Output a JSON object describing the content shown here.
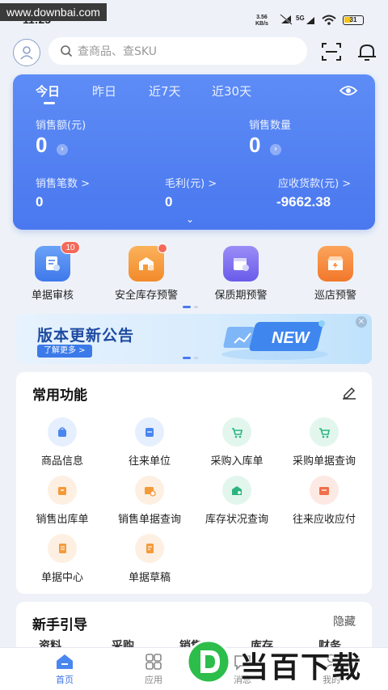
{
  "status_bar": {
    "time": "11:25",
    "watermark": "www.downbai.com",
    "net_speed_value": "3.56",
    "net_speed_unit": "KB/s",
    "signal_label": "5G",
    "battery": "31"
  },
  "header": {
    "search_placeholder": "查商品、查SKU"
  },
  "sales": {
    "tabs": [
      "今日",
      "昨日",
      "近7天",
      "近30天"
    ],
    "active_tab": 0,
    "sales_amount_label": "销售额(元)",
    "sales_amount_value": "0",
    "sales_qty_label": "销售数量",
    "sales_qty_value": "0",
    "order_count_label": "销售笔数 >",
    "order_count_value": "0",
    "gross_profit_label": "毛利(元) >",
    "gross_profit_value": "0",
    "receivable_label": "应收货款(元) >",
    "receivable_value": "-9662.38"
  },
  "alerts": [
    {
      "label": "单据审核",
      "badge": "10",
      "color": "#4a86f0"
    },
    {
      "label": "安全库存预警",
      "badge": "",
      "color": "#f59a3b"
    },
    {
      "label": "保质期预警",
      "badge": "",
      "color": "#7a6cf0"
    },
    {
      "label": "巡店预警",
      "badge": "",
      "color": "#f58a3b"
    }
  ],
  "banner": {
    "title": "版本更新公告",
    "more": "了解更多 >",
    "art_text": "NEW"
  },
  "functions": {
    "title": "常用功能",
    "items": [
      {
        "label": "商品信息",
        "icon": "bag-icon",
        "color": "#4a86f0",
        "bg": "#e6effd"
      },
      {
        "label": "往来单位",
        "icon": "contact-card-icon",
        "color": "#4a86f0",
        "bg": "#e6effd"
      },
      {
        "label": "采购入库单",
        "icon": "cart-in-icon",
        "color": "#2bb57e",
        "bg": "#e2f6ee"
      },
      {
        "label": "采购单据查询",
        "icon": "cart-search-icon",
        "color": "#2bb57e",
        "bg": "#e2f6ee"
      },
      {
        "label": "销售出库单",
        "icon": "box-out-icon",
        "color": "#f59a3b",
        "bg": "#fdf0e2"
      },
      {
        "label": "销售单据查询",
        "icon": "sale-search-icon",
        "color": "#f59a3b",
        "bg": "#fdf0e2"
      },
      {
        "label": "库存状况查询",
        "icon": "warehouse-search-icon",
        "color": "#2bb57e",
        "bg": "#e2f6ee"
      },
      {
        "label": "往来应收应付",
        "icon": "ledger-icon",
        "color": "#f0704a",
        "bg": "#fde9e3"
      },
      {
        "label": "单据中心",
        "icon": "doc-center-icon",
        "color": "#f59a3b",
        "bg": "#fdf0e2"
      },
      {
        "label": "单据草稿",
        "icon": "draft-icon",
        "color": "#f59a3b",
        "bg": "#fdf0e2"
      }
    ]
  },
  "guide": {
    "title": "新手引导",
    "hide": "隐藏",
    "tabs": [
      "资料",
      "采购",
      "销售",
      "库存",
      "财务"
    ]
  },
  "bottom_nav": {
    "items": [
      "首页",
      "应用",
      "消息",
      "我的"
    ]
  },
  "watermark_bottom": {
    "text": "当百下载"
  },
  "colors": {
    "accent": "#4a78ef",
    "badge": "#f36a5a"
  }
}
